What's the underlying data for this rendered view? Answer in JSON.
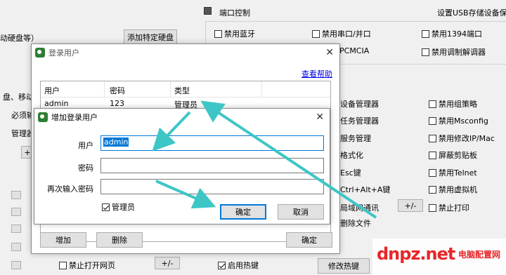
{
  "background": {
    "section_title": "端口控制",
    "usb_settings_label": "设置USB存储设备保",
    "mobile_disk_fragment": "动硬盘等）",
    "add_disk_button": "添加特定硬盘",
    "left_fragments": [
      "盘、移动",
      "必须输",
      "管理器"
    ],
    "port_options": [
      "禁用蓝牙",
      "禁用串口/并口",
      "禁用1394端口",
      "PCMCIA",
      "禁用调制解调器"
    ],
    "middle_items": [
      "设备管理器",
      "任务管理器",
      "服务管理",
      "格式化",
      "Esc键",
      "Ctrl+Alt+A键",
      "局域网通讯",
      "删除文件"
    ],
    "right_options": [
      "禁用组策略",
      "禁用Msconfig",
      "禁用修改IP/Mac",
      "屏蔽剪贴板",
      "禁用Telnet",
      "禁用虚拟机",
      "禁止打印"
    ],
    "plus_minus": "+/-",
    "disable_web": "禁止打开网页",
    "enable_hotkey": "启用热键",
    "modify_hotkey": "修改热键"
  },
  "login_dialog": {
    "title": "登录用户",
    "help_link": "查看帮助",
    "columns": [
      "用户",
      "密码",
      "类型"
    ],
    "rows": [
      {
        "user": "admin",
        "password": "123",
        "type": "管理员"
      }
    ],
    "add_button": "增加",
    "delete_button": "删除",
    "ok_button": "确定"
  },
  "add_dialog": {
    "title": "增加登录用户",
    "user_label": "用户",
    "user_value": "admin",
    "password_label": "密码",
    "password_value": "",
    "confirm_label": "再次输入密码",
    "confirm_value": "",
    "admin_checkbox": "管理员",
    "admin_checked": true,
    "ok_button": "确定",
    "cancel_button": "取消"
  },
  "watermark": {
    "logo": "dnpz.net",
    "site_name": "电脑配置网"
  },
  "colors": {
    "accent": "#0078d7",
    "arrow": "#3ec6c6",
    "logo_red": "#e8262a"
  }
}
